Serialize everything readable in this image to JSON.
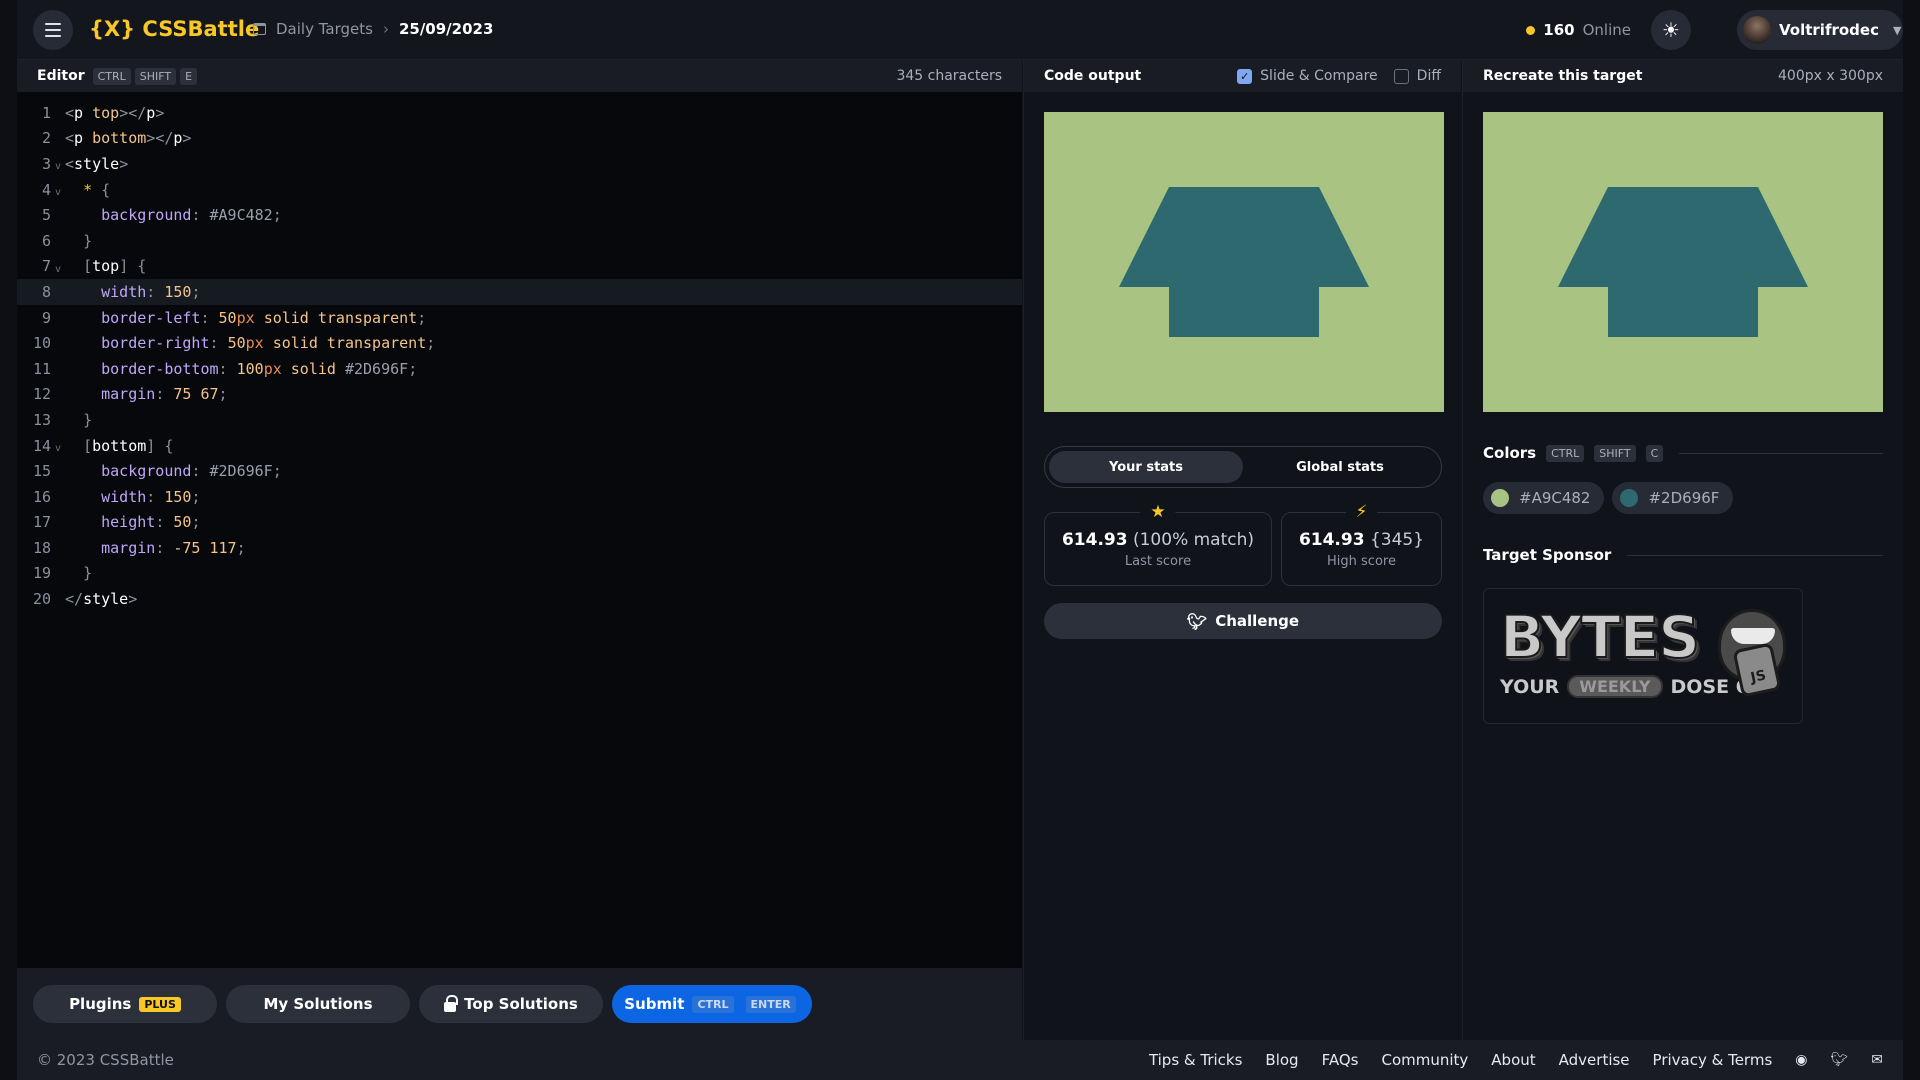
{
  "header": {
    "logo": "{X} CSSBattle",
    "breadcrumb_parent": "Daily Targets",
    "breadcrumb_sep": "›",
    "breadcrumb_current": "25/09/2023",
    "online_count": "160",
    "online_label": "Online",
    "username": "Voltrifrodec"
  },
  "editor": {
    "title": "Editor",
    "shortcut": [
      "CTRL",
      "SHIFT",
      "E"
    ],
    "characters": "345 characters",
    "active_line": 8,
    "lines": [
      "<p top></p>",
      "<p bottom></p>",
      "<style>",
      "  * {",
      "    background: #A9C482;",
      "  }",
      "  [top] {",
      "    width: 150;",
      "    border-left: 50px solid transparent;",
      "    border-right: 50px solid transparent;",
      "    border-bottom: 100px solid #2D696F;",
      "    margin: 75 67;",
      "  }",
      "  [bottom] {",
      "    background: #2D696F;",
      "    width: 150;",
      "    height: 50;",
      "    margin: -75 117;",
      "  }",
      "</style>"
    ]
  },
  "actions": {
    "plugins": "Plugins",
    "plugins_badge": "PLUS",
    "my_solutions": "My Solutions",
    "top_solutions": "Top Solutions",
    "submit": "Submit",
    "submit_keys": [
      "CTRL",
      "ENTER"
    ]
  },
  "output": {
    "title": "Code output",
    "slide_compare": "Slide & Compare",
    "slide_compare_checked": true,
    "diff": "Diff",
    "diff_checked": false,
    "tabs": [
      "Your stats",
      "Global stats"
    ],
    "active_tab": "Your stats",
    "last_score": "614.93",
    "last_match": "(100% match)",
    "last_label": "Last score",
    "high_score": "614.93",
    "high_chars": "{345}",
    "high_label": "High score",
    "challenge": "Challenge"
  },
  "target": {
    "title": "Recreate this target",
    "dimensions": "400px x 300px",
    "colors_title": "Colors",
    "colors_shortcut": [
      "CTRL",
      "SHIFT",
      "C"
    ],
    "colors": [
      "#A9C482",
      "#2D696F"
    ],
    "sponsor_title": "Target Sponsor",
    "sponsor_logo_text": "BYTES",
    "sponsor_tagline_a": "YOUR",
    "sponsor_tagline_b": "WEEKLY",
    "sponsor_tagline_c": "DOSE OF",
    "sponsor_tongue": "JS"
  },
  "footer": {
    "copyright": "© 2023 CSSBattle",
    "links": [
      "Tips & Tricks",
      "Blog",
      "FAQs",
      "Community",
      "About",
      "Advertise",
      "Privacy & Terms"
    ]
  },
  "theme": {
    "accent": "#f7c827",
    "submit_blue": "#0c66e4",
    "canvas_bg": "#A9C482",
    "shape_color": "#2D696F"
  }
}
